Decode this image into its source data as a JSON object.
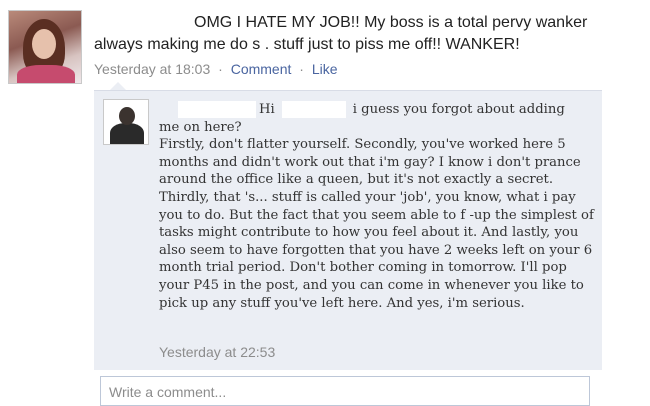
{
  "post": {
    "line1": "OMG I HATE MY JOB!! My boss is a total pervy wanker",
    "line2": "always making me do s . stuff just to piss me off!! WANKER!",
    "timestamp": "Yesterday at 18:03",
    "comment_link": "Comment",
    "like_link": "Like",
    "separator": "·"
  },
  "comment": {
    "greeting_part1": "Hi",
    "greeting_part2": "i guess you forgot about adding",
    "paragraphs": [
      "me on here?",
      "Firstly, don't flatter yourself. Secondly, you've worked here 5 months and didn't work out that i'm gay? I know i don't prance around the office like a queen, but it's not exactly a secret. Thirdly, that 's... stuff is called your 'job', you know, what i pay you to do. But the fact that you seem able to f -up the simplest of tasks might contribute to how you feel about it. And lastly, you also seem to have forgotten that you have 2 weeks left on your 6 month trial period. Don't bother coming in tomorrow. I'll pop your P45 in the post, and you can come in whenever you like to pick up any stuff you've left here. And yes, i'm serious."
    ],
    "timestamp": "Yesterday at 22:53"
  },
  "composer": {
    "placeholder": "Write a comment..."
  },
  "colors": {
    "link": "#4a65a0",
    "meta_gray": "#8c8c8c",
    "comment_bg": "#ebeef4"
  }
}
